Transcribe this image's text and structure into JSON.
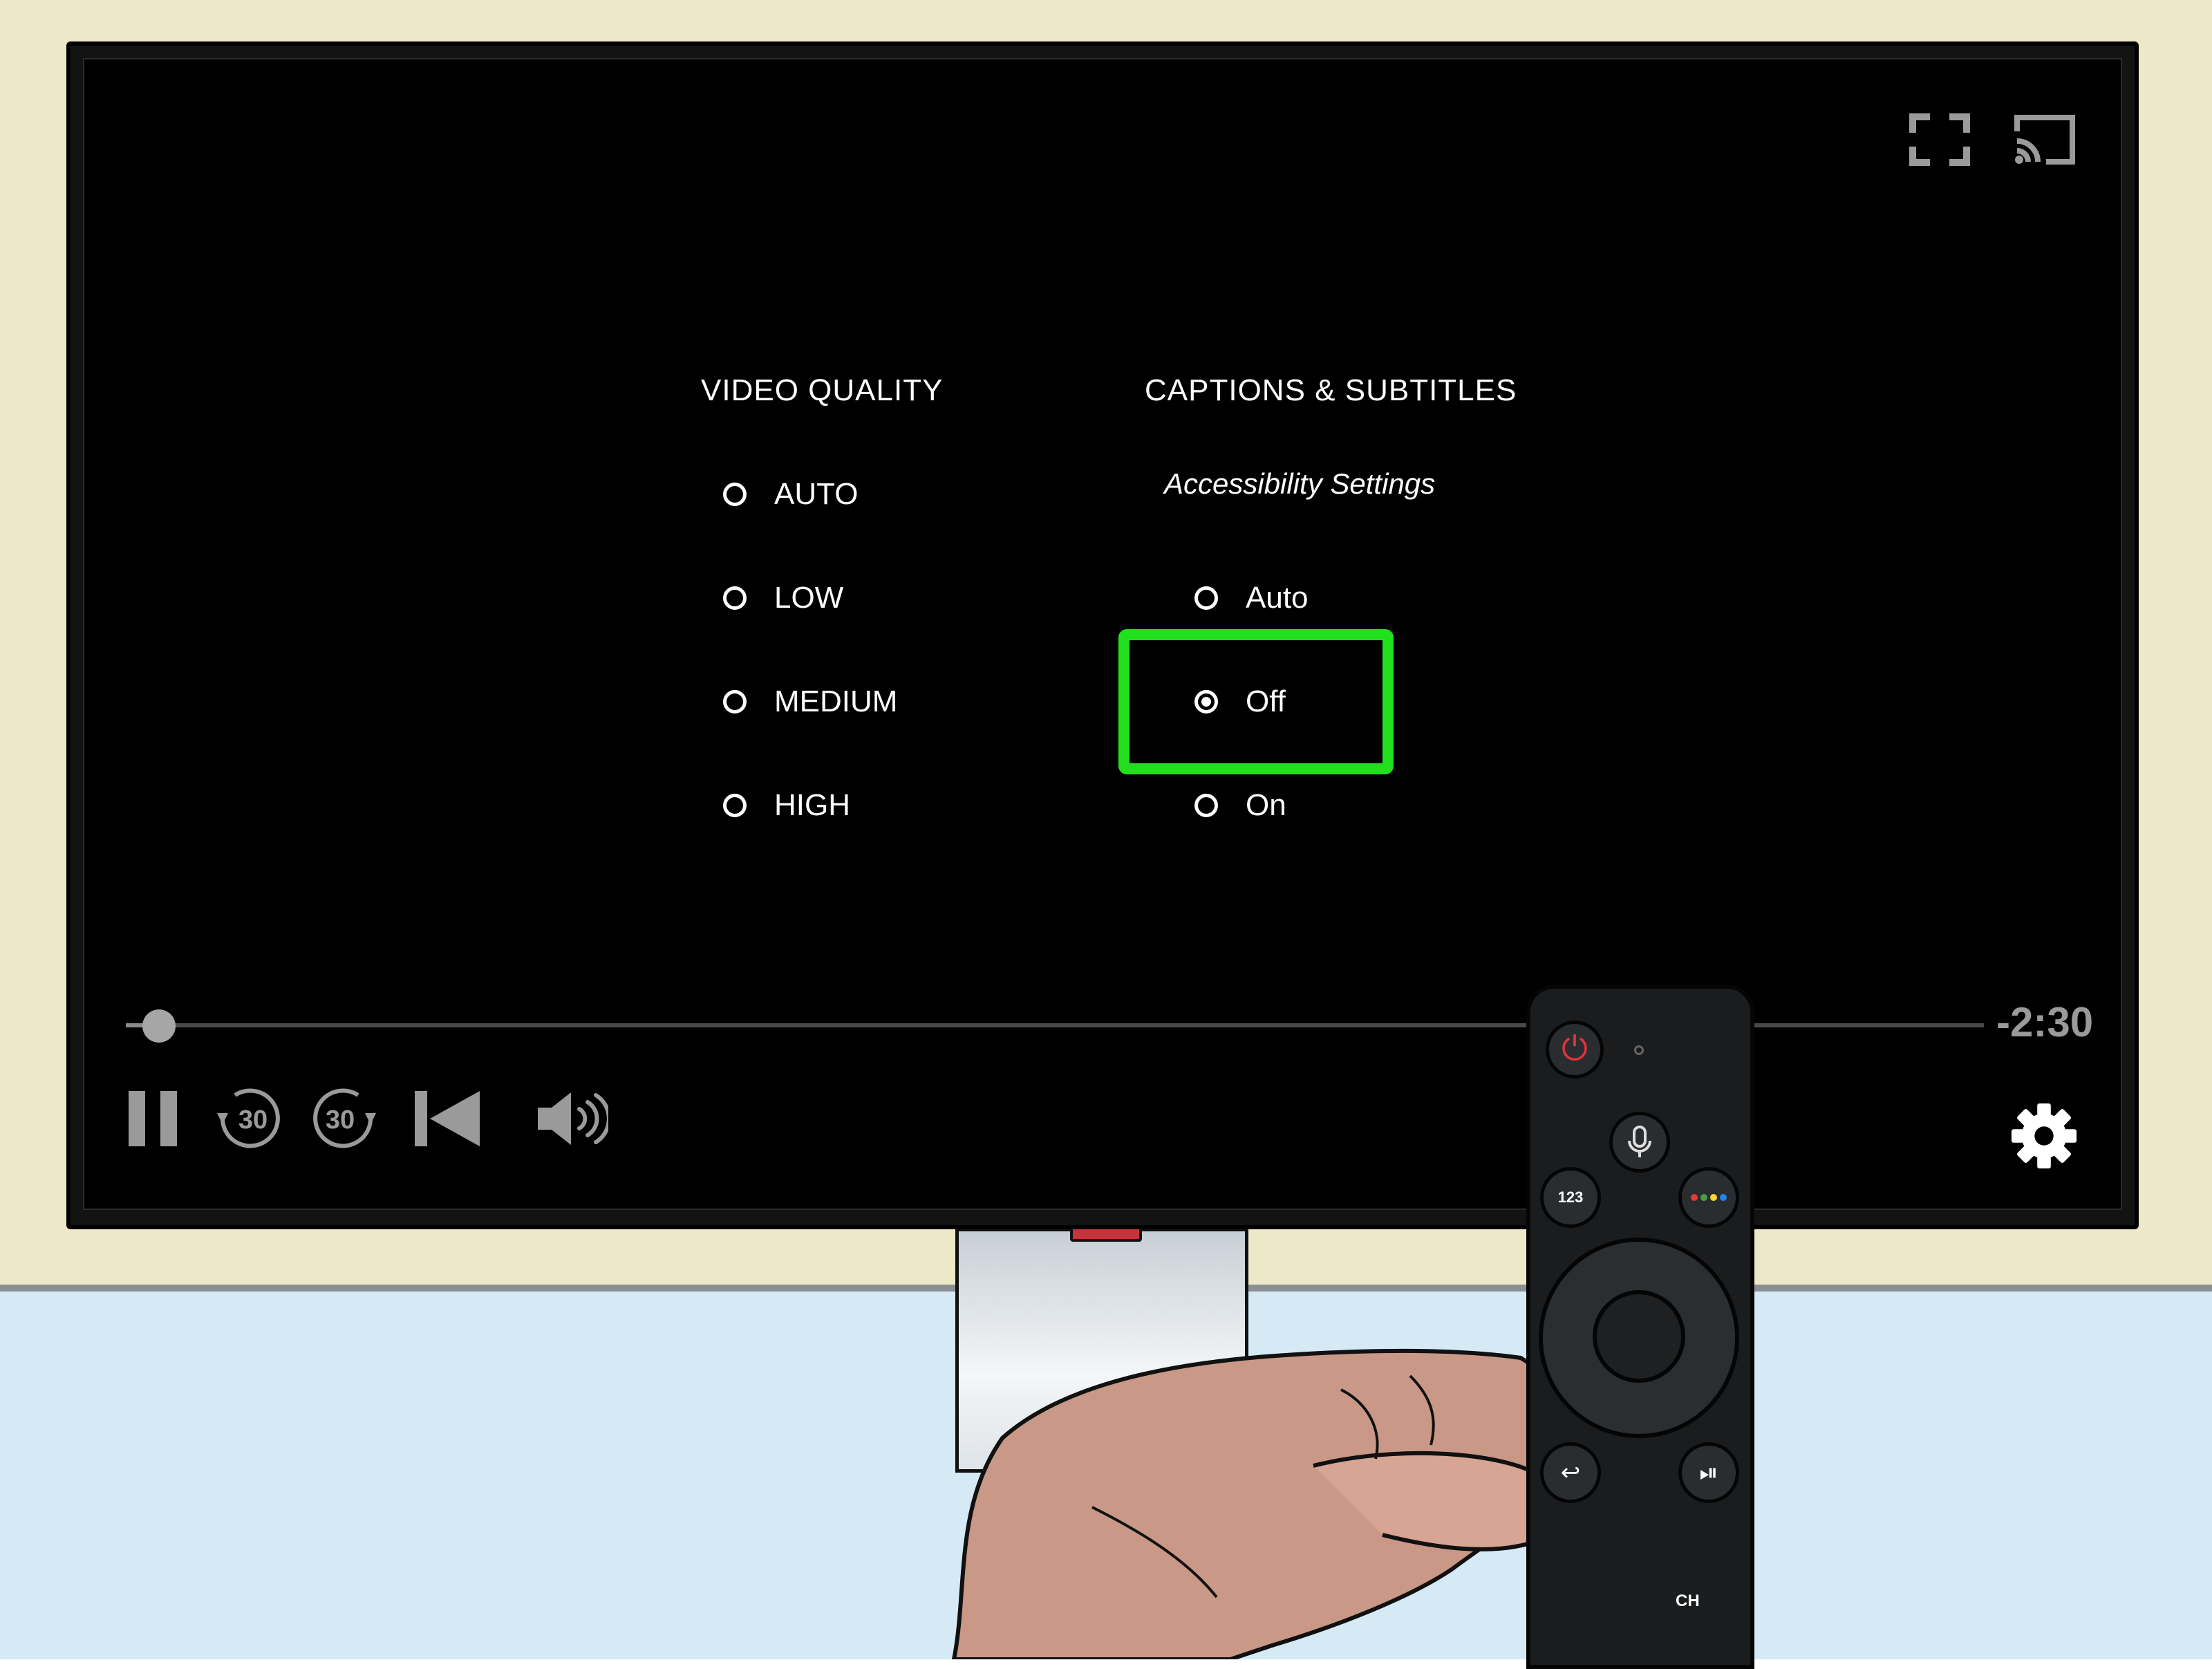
{
  "player": {
    "video_quality": {
      "title": "VIDEO QUALITY",
      "options": [
        {
          "label": "AUTO",
          "selected": false
        },
        {
          "label": "LOW",
          "selected": false
        },
        {
          "label": "MEDIUM",
          "selected": false
        },
        {
          "label": "HIGH",
          "selected": false
        }
      ]
    },
    "captions": {
      "title": "CAPTIONS & SUBTITLES",
      "subtitle": "Accessibility Settings",
      "options": [
        {
          "label": "Auto",
          "selected": false
        },
        {
          "label": "Off",
          "selected": true
        },
        {
          "label": "On",
          "selected": false
        }
      ],
      "highlighted_option": "Off"
    },
    "playback": {
      "time_remaining": "-2:30",
      "progress": 0.01,
      "rewind_label": "30",
      "forward_label": "30"
    },
    "icons": [
      "fullscreen-icon",
      "cast-icon",
      "pause-icon",
      "rewind-30-icon",
      "forward-30-icon",
      "previous-track-icon",
      "volume-icon",
      "settings-gear-icon"
    ]
  },
  "remote": {
    "button_123": "123",
    "ch_label": "CH"
  },
  "colors": {
    "highlight": "#22e01e",
    "screen": "#000000",
    "wall": "#ece8c8",
    "floor": "#d6eaf6",
    "power": "#e0323a"
  }
}
